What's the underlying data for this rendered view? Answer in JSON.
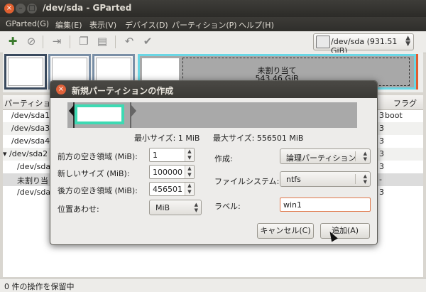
{
  "window": {
    "title": "/dev/sda - GParted"
  },
  "menu": [
    "GParted(G)",
    "編集(E)",
    "表示(V)",
    "デバイス(D)",
    "パーティション(P)",
    "ヘルプ(H)"
  ],
  "toolbar": {
    "icons": [
      "new-partition-icon",
      "delete-icon",
      "resize-move-icon",
      "copy-icon",
      "paste-icon",
      "undo-icon",
      "apply-icon"
    ],
    "device": "/dev/sda  (931.51 GiB)"
  },
  "disk_map": {
    "unallocated_label": "未割り当て",
    "unallocated_size": "543.46 GiB"
  },
  "partition_list": {
    "headers": {
      "partition": "パーティション",
      "flags": "フラグ"
    },
    "rows": [
      {
        "name": "/dev/sda1",
        "extra": "3",
        "flags": "boot"
      },
      {
        "name": "/dev/sda3",
        "extra": "3",
        "flags": ""
      },
      {
        "name": "/dev/sda4",
        "extra": "3",
        "flags": ""
      },
      {
        "name": "▾ /dev/sda2",
        "extra": "3",
        "flags": ""
      },
      {
        "name": "/dev/sda",
        "extra": "3",
        "flags": ""
      },
      {
        "name": "未割り当",
        "extra": "-",
        "flags": ""
      },
      {
        "name": "/dev/sda",
        "extra": "3",
        "flags": ""
      }
    ]
  },
  "status": {
    "text": "0 件の操作を保留中"
  },
  "dialog": {
    "title": "新規パーティションの作成",
    "min_size": "最小サイズ: 1 MiB",
    "max_size": "最大サイズ: 556501 MiB",
    "fields": {
      "free_before_label": "前方の空き領域 (MiB):",
      "free_before_value": "1",
      "new_size_label": "新しいサイズ (MiB):",
      "new_size_value": "100000",
      "free_after_label": "後方の空き領域 (MiB):",
      "free_after_value": "456501",
      "align_label": "位置あわせ:",
      "align_value": "MiB",
      "create_as_label": "作成:",
      "create_as_value": "論理パーティション",
      "filesystem_label": "ファイルシステム:",
      "filesystem_value": "ntfs",
      "label_label": "ラベル:",
      "label_value": "win1"
    },
    "cancel": "キャンセル(C)",
    "add": "追加(A)"
  }
}
